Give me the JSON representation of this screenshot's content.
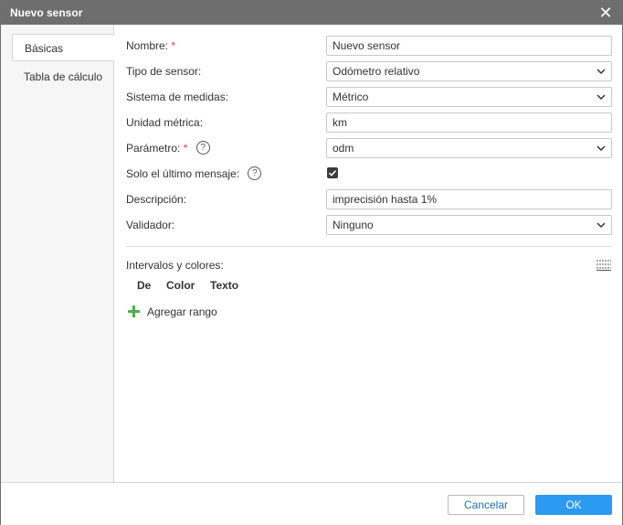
{
  "window": {
    "title": "Nuevo sensor"
  },
  "tabs": [
    {
      "label": "Básicas",
      "active": true
    },
    {
      "label": "Tabla de cálculo",
      "active": false
    }
  ],
  "form": {
    "name_label": "Nombre:",
    "name_value": "Nuevo sensor",
    "type_label": "Tipo de sensor:",
    "type_value": "Odómetro relativo",
    "units_label": "Sistema de medidas:",
    "units_value": "Métrico",
    "metric_unit_label": "Unidad métrica:",
    "metric_unit_value": "km",
    "parameter_label": "Parámetro:",
    "parameter_value": "odm",
    "last_message_label": "Solo el último mensaje:",
    "last_message_checked": true,
    "description_label": "Descripción:",
    "description_value": "imprecisión hasta 1%",
    "validator_label": "Validador:",
    "validator_value": "Ninguno",
    "required_mark": "*",
    "help_glyph": "?"
  },
  "intervals": {
    "label": "Intervalos y colores:",
    "columns": [
      "De",
      "Color",
      "Texto"
    ],
    "add_label": "Agregar rango"
  },
  "footer": {
    "cancel_label": "Cancelar",
    "ok_label": "OK"
  },
  "icons": {
    "close": "close-icon",
    "chevron": "chevron-down-icon",
    "help": "help-icon",
    "grid": "table-grid-icon",
    "add": "plus-icon"
  },
  "colors": {
    "titlebar": "#6e6e6e",
    "accent": "#2b9af3",
    "required": "#e53935",
    "add_icon": "#4caf50",
    "link": "#1e6fb8"
  }
}
